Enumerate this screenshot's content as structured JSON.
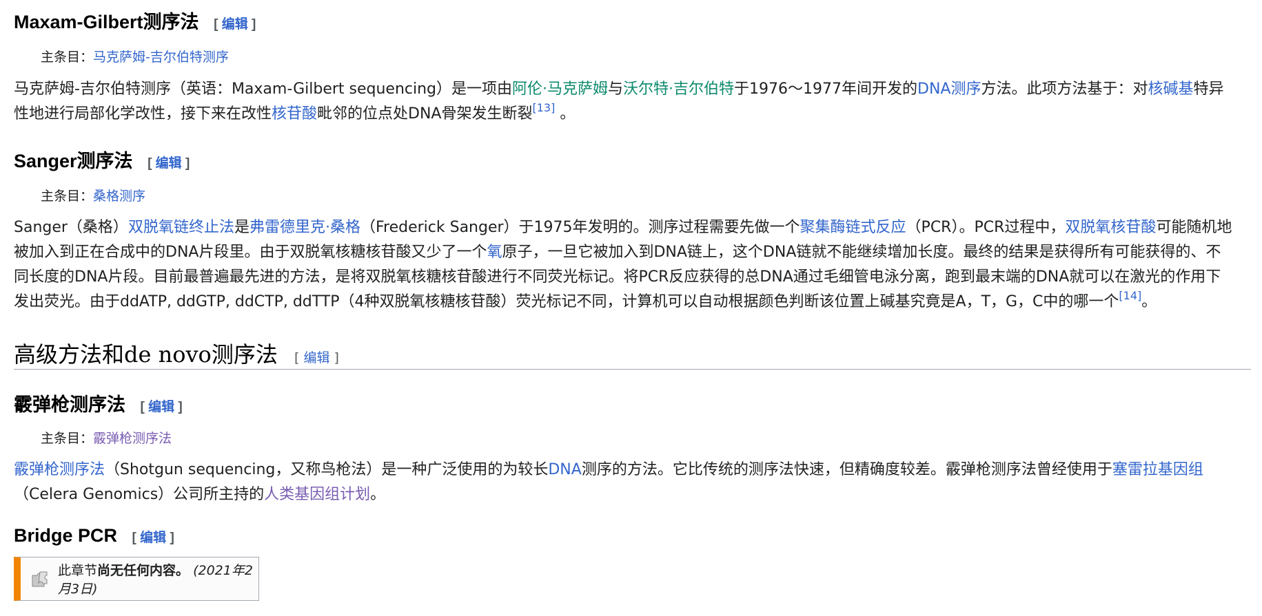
{
  "edit_label": "编辑",
  "edit_open": "[ ",
  "edit_close": " ]",
  "hatnote_prefix": "主条目：",
  "sec_maxam": {
    "title": "Maxam-Gilbert测序法",
    "hatnote_link": "马克萨姆-吉尔伯特测序",
    "p1": "马克萨姆-吉尔伯特测序（英语：Maxam-Gilbert sequencing）是一项由",
    "l_maxam": "阿伦·马克萨姆",
    "p2": "与",
    "l_gilbert": "沃尔特·吉尔伯特",
    "p3": "于1976～1977年间开发的",
    "l_dnaseq": "DNA测序",
    "p4": "方法。此项方法基于：对",
    "l_base": "核碱基",
    "p5": "特异",
    "p6": "性地进行局部化学改性，接下来在改性",
    "l_nucleotide": "核苷酸",
    "p7": "毗邻的位点处DNA骨架发生断裂",
    "ref": "[13]",
    "p8": " 。"
  },
  "sec_sanger": {
    "title": "Sanger测序法",
    "hatnote_link": "桑格测序",
    "a1": "Sanger（桑格）",
    "l_ddseq": "双脱氧链终止法",
    "a2": "是",
    "l_fsanger": "弗雷德里克·桑格",
    "a3": "（Frederick Sanger）于1975年发明的。测序过程需要先做一个",
    "l_pcr": "聚集酶链式反应",
    "a4": "（PCR）。PCR过程中，",
    "l_ddntp": "双脱氧核苷酸",
    "a5": "可能随机地",
    "b1": "被加入到正在合成中的DNA片段里。由于双脱氧核糖核苷酸又少了一个",
    "l_oxygen": "氧",
    "b2": "原子，一旦它被加入到DNA链上，这个DNA链就不能继续增加长度。最终的结果是获得所有可能获得的、不",
    "c1": "同长度的DNA片段。目前最普遍最先进的方法，是将双脱氧核糖核苷酸进行不同荧光标记。将PCR反应获得的总DNA通过毛细管电泳分离，跑到最末端的DNA就可以在激光的作用下",
    "d1": "发出荧光。由于ddATP, ddGTP, ddCTP, ddTTP（4种双脱氧核糖核苷酸）荧光标记不同，计算机可以自动根据颜色判断该位置上碱基究竟是A，T，G，C中的哪一个",
    "ref": "[14]",
    "d2": "。"
  },
  "sec_advanced": {
    "title": "高级方法和de novo测序法"
  },
  "sec_shotgun": {
    "title": "霰弹枪测序法",
    "hatnote_link": "霰弹枪测序法",
    "l_shotgun": "霰弹枪测序法",
    "s1": "（Shotgun sequencing，又称鸟枪法）是一种广泛使用的为较长",
    "l_dna": "DNA",
    "s2": "测序的方法。它比传统的测序法快速，但精确度较差。霰弹枪测序法曾经使用于",
    "l_celera": "塞雷拉基因组",
    "s3": "（Celera Genomics）公司所主持的",
    "l_hgp": "人类基因组计划",
    "s4": "。"
  },
  "sec_bridge": {
    "title": "Bridge PCR",
    "notice_pre": "此章节",
    "notice_bold": "尚无任何内容",
    "notice_dot": "。",
    "notice_date": "(2021年2月3日)",
    "notice_icon": "puzzle-pieces-icon"
  },
  "colors": {
    "link": "#3366cc",
    "link_visited": "#795cb2",
    "link_green": "#0b8a6b",
    "text": "#202122",
    "notice_bar": "#f28500"
  }
}
